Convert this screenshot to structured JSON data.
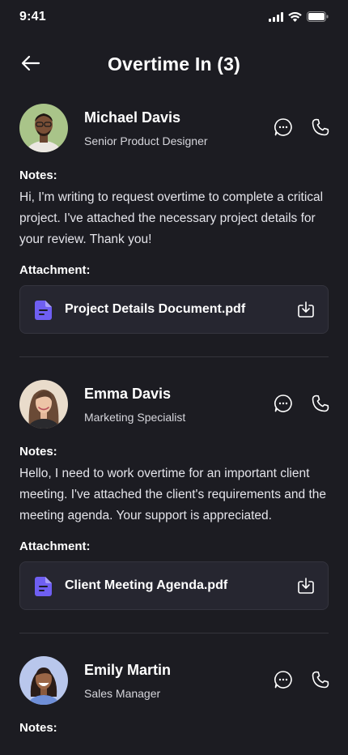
{
  "status": {
    "time": "9:41"
  },
  "header": {
    "title": "Overtime In (3)"
  },
  "requests": [
    {
      "name": "Michael Davis",
      "role": "Senior Product Designer",
      "notes_label": "Notes:",
      "notes": "Hi, I'm writing to request overtime to complete a critical project. I've attached the necessary project details for your review. Thank you!",
      "attachment_label": "Attachment:",
      "attachment": "Project Details Document.pdf"
    },
    {
      "name": "Emma Davis",
      "role": "Marketing Specialist",
      "notes_label": "Notes:",
      "notes": "Hello, I need to work overtime for an important client meeting. I've attached the client's requirements and the meeting agenda. Your support is appreciated.",
      "attachment_label": "Attachment:",
      "attachment": "Client Meeting Agenda.pdf"
    },
    {
      "name": "Emily Martin",
      "role": "Sales Manager",
      "notes_label": "Notes:"
    }
  ],
  "colors": {
    "background": "#1c1c22",
    "accent": "#6f5ff2",
    "card": "#262630"
  },
  "icons": [
    "back-arrow-icon",
    "chat-bubble-icon",
    "phone-icon",
    "file-icon",
    "download-icon"
  ]
}
